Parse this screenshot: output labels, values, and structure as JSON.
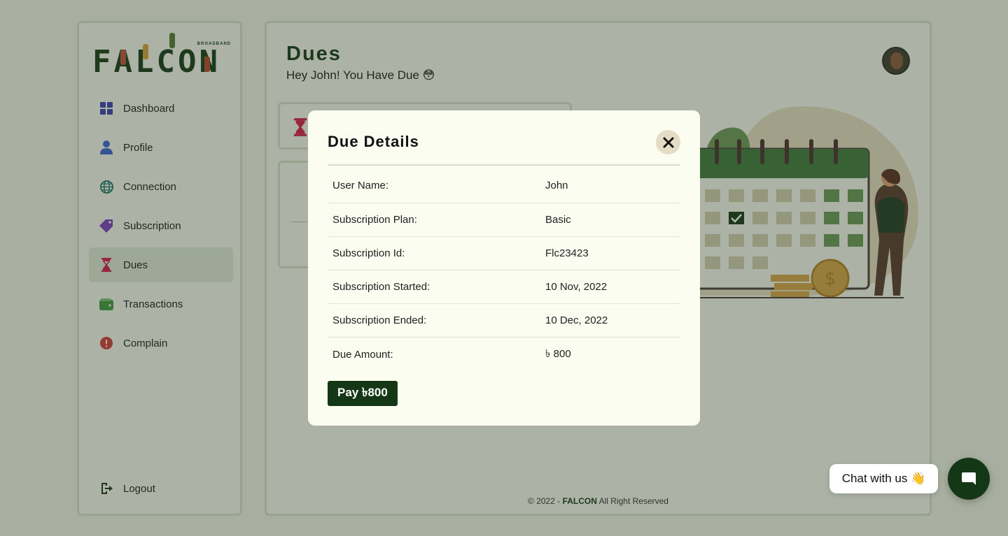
{
  "brand": {
    "logo_text": "FALCON",
    "logo_sub": "BROADBAND"
  },
  "sidebar": {
    "items": [
      {
        "label": "Dashboard",
        "icon": "dashboard-icon"
      },
      {
        "label": "Profile",
        "icon": "user-icon"
      },
      {
        "label": "Connection",
        "icon": "globe-icon"
      },
      {
        "label": "Subscription",
        "icon": "tag-icon"
      },
      {
        "label": "Dues",
        "icon": "hourglass-icon",
        "active": true
      },
      {
        "label": "Transactions",
        "icon": "wallet-icon"
      },
      {
        "label": "Complain",
        "icon": "alert-icon"
      }
    ],
    "logout_label": "Logout"
  },
  "header": {
    "title": "Dues",
    "subtitle": "Hey John! You Have Due 😳"
  },
  "modal": {
    "title": "Due Details",
    "rows": [
      {
        "key": "User Name:",
        "value": "John"
      },
      {
        "key": "Subscription Plan:",
        "value": "Basic"
      },
      {
        "key": "Subscription Id:",
        "value": "Flc23423"
      },
      {
        "key": "Subscription Started:",
        "value": "10 Nov, 2022"
      },
      {
        "key": "Subscription Ended:",
        "value": "10 Dec, 2022"
      },
      {
        "key": "Due Amount:",
        "value": "৳ 800"
      }
    ],
    "pay_label": "Pay ৳800"
  },
  "footer": {
    "prefix": "© 2022 - ",
    "brand": "FALCON",
    "suffix": " All Right Reserved"
  },
  "chat": {
    "bubble_label": "Chat with us 👋"
  },
  "colors": {
    "brand": "#143815",
    "dashboard": "#3b3fb5",
    "profile": "#3d65d6",
    "connection": "#1f7a70",
    "subscription": "#7b3fc2",
    "dues": "#d51a4a",
    "transactions": "#3f9a3f",
    "complain": "#d23a3a"
  }
}
